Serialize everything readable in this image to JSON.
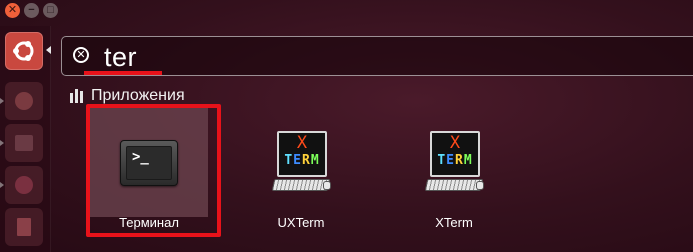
{
  "window": {
    "close_icon": "close-icon",
    "minimize_icon": "minimize-icon",
    "maximize_icon": "maximize-icon"
  },
  "launcher": {
    "items": [
      "ubuntu-dash-icon",
      "app-icon",
      "app-icon",
      "app-icon",
      "app-icon",
      "app-icon"
    ]
  },
  "search": {
    "clear_icon": "clear-icon",
    "value": "ter",
    "underline_color": "#e8121a"
  },
  "category": {
    "icon": "applications-icon",
    "label": "Приложения"
  },
  "apps": [
    {
      "name": "Терминал",
      "icon": "terminal-icon",
      "selected": true,
      "prompt": ">_"
    },
    {
      "name": "UXTerm",
      "icon": "xterm-icon",
      "selected": false
    },
    {
      "name": "XTerm",
      "icon": "xterm-icon",
      "selected": false
    }
  ],
  "xterm_icon_text": {
    "x": "X",
    "term": "TERM"
  },
  "accent_color": "#e8121a"
}
